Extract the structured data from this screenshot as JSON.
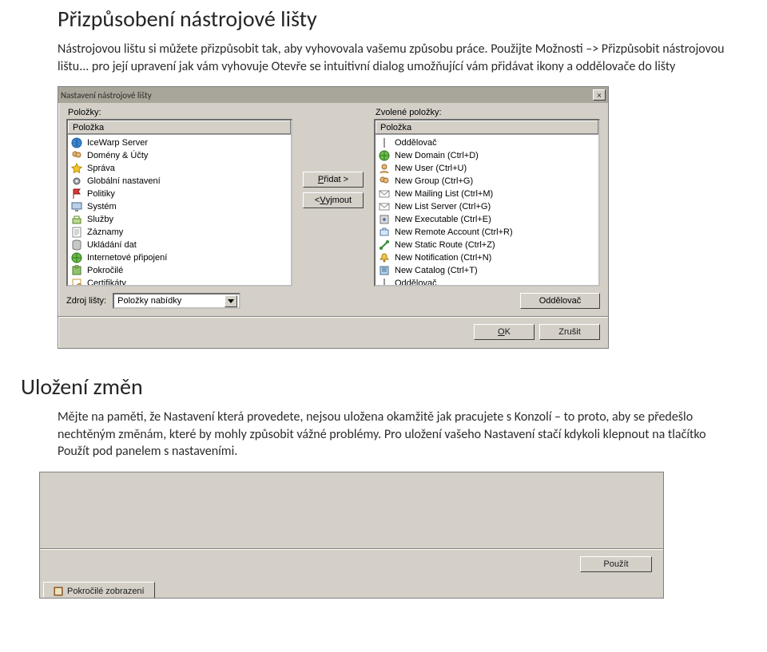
{
  "section1": {
    "heading": "Přizpůsobení nástrojové lišty",
    "p1": "Nástrojovou lištu si můžete přizpůsobit tak, aby vyhovovala vašemu způsobu práce. Použijte Možnosti –> Přizpůsobit nástrojovou lištu... pro její upravení jak vám vyhovuje Otevře se intuitivní dialog umožňující vám přidávat ikony a oddělovače do lišty"
  },
  "dialog": {
    "title": "Nastavení nástrojové lišty",
    "close": "×",
    "left_label": "Položky:",
    "right_label": "Zvolené položky:",
    "left_header": "Položka",
    "right_header": "Položka",
    "add_btn_pre": "",
    "add_btn_u": "P",
    "add_btn_post": "řidat >",
    "remove_btn_pre": "< ",
    "remove_btn_u": "V",
    "remove_btn_post": "yjmout",
    "left_items": [
      {
        "label": "IceWarp Server",
        "icon": "globe-blue"
      },
      {
        "label": "Domény & Účty",
        "icon": "users"
      },
      {
        "label": "Správa",
        "icon": "star"
      },
      {
        "label": "Globální nastavení",
        "icon": "gear"
      },
      {
        "label": "Politiky",
        "icon": "flag"
      },
      {
        "label": "Systém",
        "icon": "computer"
      },
      {
        "label": "Služby",
        "icon": "service"
      },
      {
        "label": "Záznamy",
        "icon": "log"
      },
      {
        "label": "Ukládání dat",
        "icon": "db"
      },
      {
        "label": "Internetové připojení",
        "icon": "globe-green"
      },
      {
        "label": "Pokročilé",
        "icon": "puzzle"
      },
      {
        "label": "Certifikáty",
        "icon": "cert"
      }
    ],
    "right_items": [
      {
        "label": "Oddělovač",
        "icon": "sep"
      },
      {
        "label": "New Domain (Ctrl+D)",
        "icon": "globe-green"
      },
      {
        "label": "New User (Ctrl+U)",
        "icon": "user"
      },
      {
        "label": "New Group (Ctrl+G)",
        "icon": "users"
      },
      {
        "label": "New Mailing List (Ctrl+M)",
        "icon": "mail"
      },
      {
        "label": "New List Server (Ctrl+G)",
        "icon": "mail"
      },
      {
        "label": "New Executable (Ctrl+E)",
        "icon": "exe"
      },
      {
        "label": "New Remote Account (Ctrl+R)",
        "icon": "remote"
      },
      {
        "label": "New Static Route (Ctrl+Z)",
        "icon": "route"
      },
      {
        "label": "New Notification (Ctrl+N)",
        "icon": "bell"
      },
      {
        "label": "New Catalog (Ctrl+T)",
        "icon": "catalog"
      },
      {
        "label": "Oddělovač",
        "icon": "sep"
      }
    ],
    "src_label": "Zdroj lišty:",
    "src_combo": "Položky nabídky",
    "sep_btn": "Oddělovač",
    "ok_u": "O",
    "ok_post": "K",
    "cancel": "Zrušit"
  },
  "section2": {
    "heading": "Uložení změn",
    "p1": "Mějte na paměti, že Nastavení která provedete, nejsou uložena okamžitě jak pracujete s Konzolí – to proto, aby se předešlo nechtěným změnám, které by mohly způsobit vážné problémy. Pro uložení vašeho Nastavení stačí kdykoli klepnout na tlačítko Použít pod panelem s nastaveními."
  },
  "panel2": {
    "apply": "Použít",
    "tab_label": "Pokročilé zobrazení"
  }
}
